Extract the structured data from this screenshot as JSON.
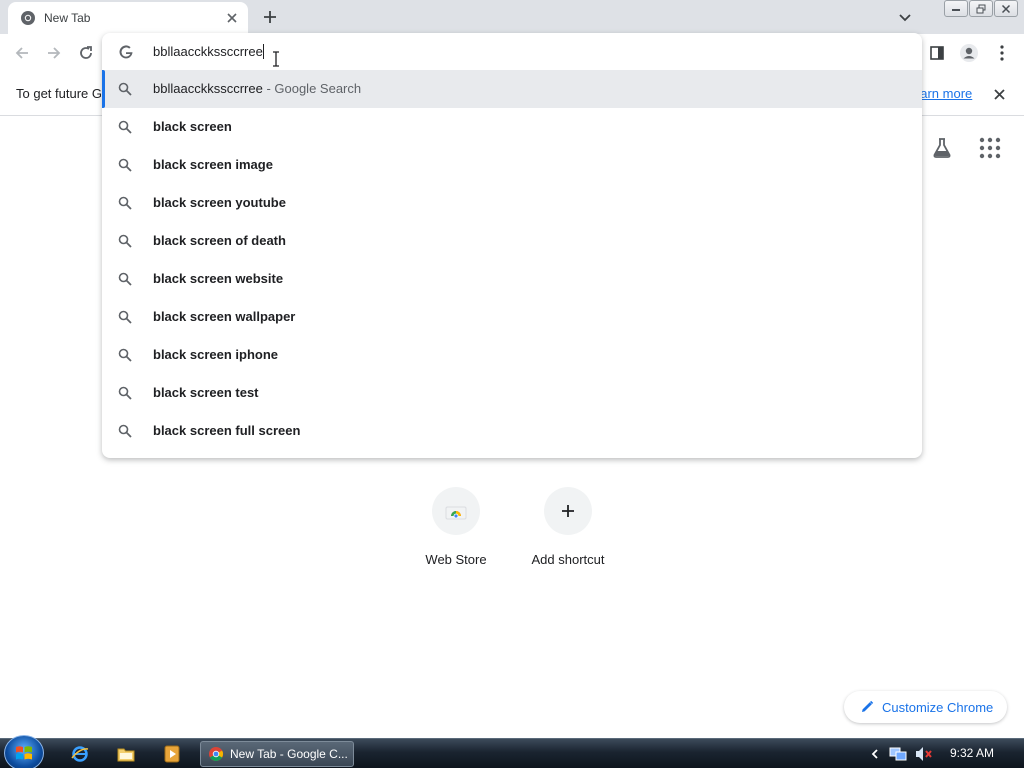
{
  "tab": {
    "title": "New Tab"
  },
  "omnibox": {
    "value": "bbllaacckkssccrree"
  },
  "suggestions": [
    {
      "query": "bbllaacckkssccrree",
      "suffix": " - Google Search"
    },
    {
      "query": "black screen"
    },
    {
      "query": "black screen image"
    },
    {
      "query": "black screen youtube"
    },
    {
      "query": "black screen of death"
    },
    {
      "query": "black screen website"
    },
    {
      "query": "black screen wallpaper"
    },
    {
      "query": "black screen iphone"
    },
    {
      "query": "black screen test"
    },
    {
      "query": "black screen full screen"
    }
  ],
  "infobar": {
    "text": "To get future G",
    "link": "earn more"
  },
  "shortcuts": [
    {
      "label": "Web Store"
    },
    {
      "label": "Add shortcut"
    }
  ],
  "customize": {
    "label": "Customize Chrome"
  },
  "taskbar": {
    "window_label": "New Tab - Google C...",
    "clock": "9:32 AM"
  },
  "colors": {
    "accent": "#1a73e8",
    "selected_row": "#e8eaed"
  }
}
